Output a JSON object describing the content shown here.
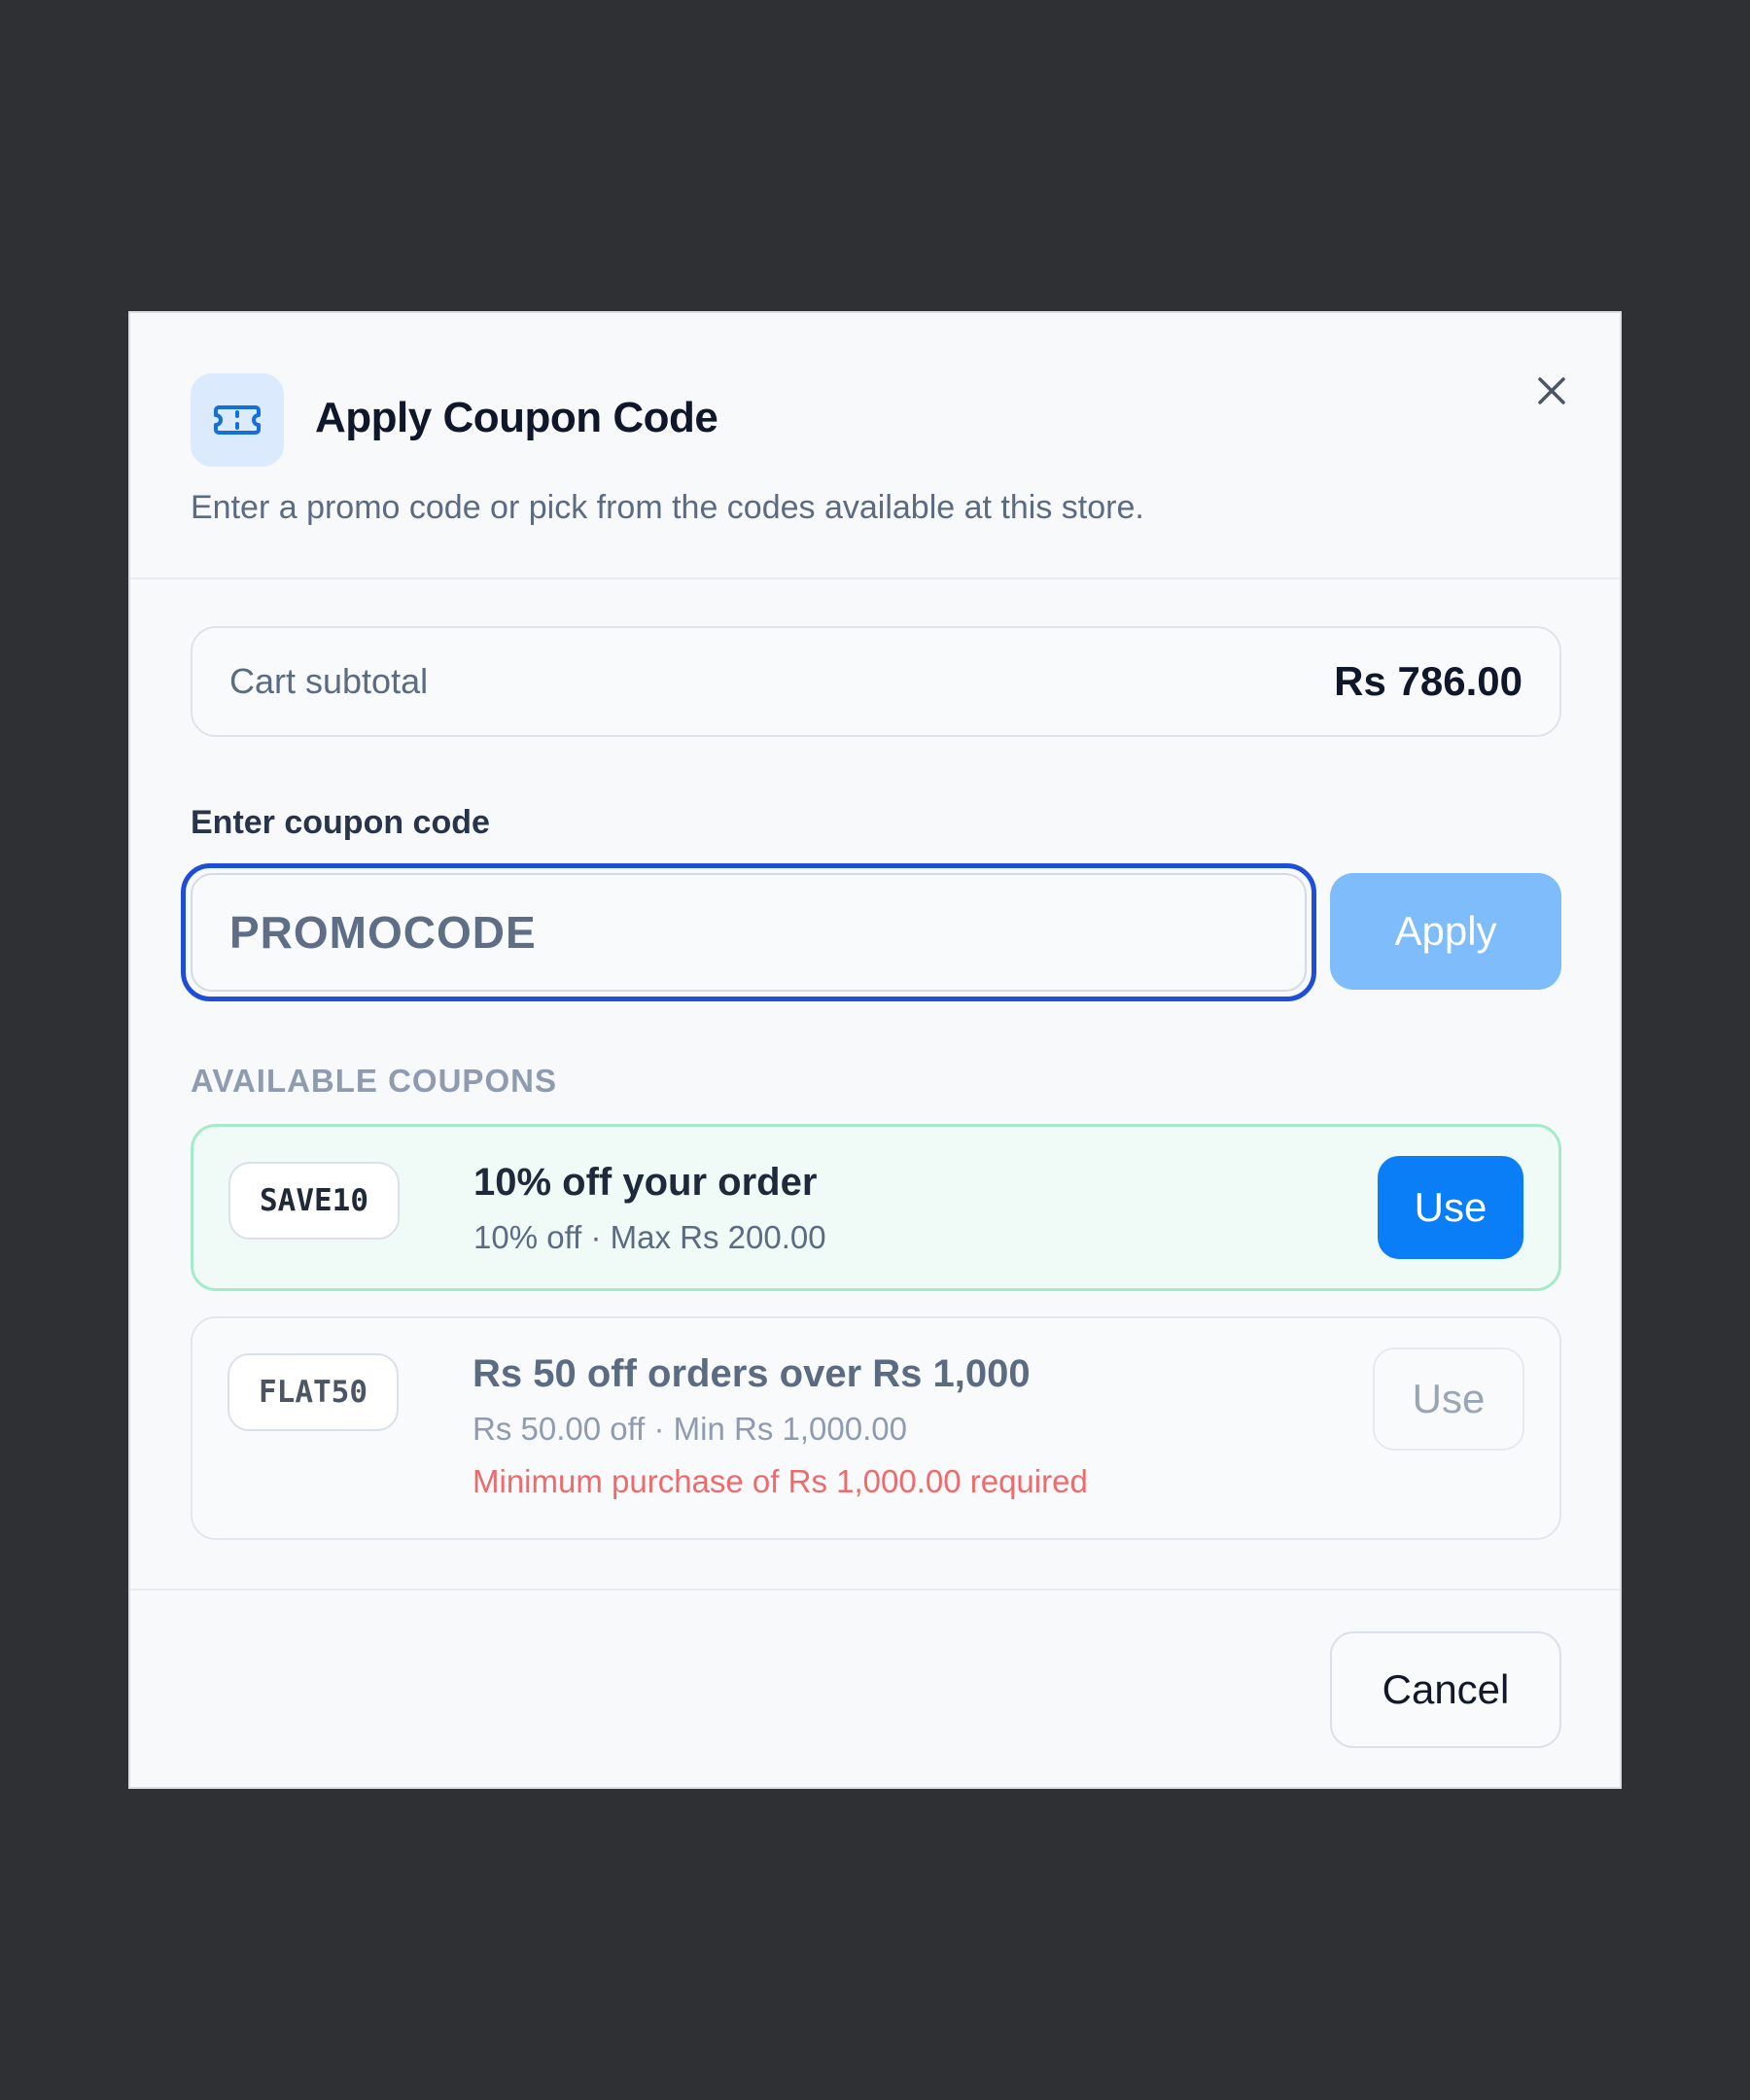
{
  "dialog": {
    "title": "Apply Coupon Code",
    "subtitle": "Enter a promo code or pick from the codes available at this store.",
    "header_icon": "ticket-icon",
    "close_icon": "close-icon"
  },
  "cart": {
    "subtotal_label": "Cart subtotal",
    "subtotal_value": "Rs 786.00"
  },
  "coupon_input": {
    "label": "Enter coupon code",
    "value": "",
    "placeholder": "PROMOCODE",
    "apply_label": "Apply"
  },
  "available": {
    "section_label": "AVAILABLE COUPONS",
    "coupons": [
      {
        "code": "SAVE10",
        "title": "10% off your order",
        "meta": "10% off · Max Rs 200.00",
        "use_label": "Use",
        "eligible": true
      },
      {
        "code": "FLAT50",
        "title": "Rs 50 off orders over Rs 1,000",
        "meta": "Rs 50.00 off · Min Rs 1,000.00",
        "warning": "Minimum purchase of Rs 1,000.00 required",
        "use_label": "Use",
        "eligible": false
      }
    ]
  },
  "footer": {
    "cancel_label": "Cancel"
  },
  "colors": {
    "backdrop": "#2f3033",
    "primary": "#0a7ef6",
    "apply_disabled": "#7ebcfc",
    "focus_ring": "#1d4ed8",
    "eligible_border": "#a3ebcb",
    "warning_text": "#ef6b6b"
  }
}
